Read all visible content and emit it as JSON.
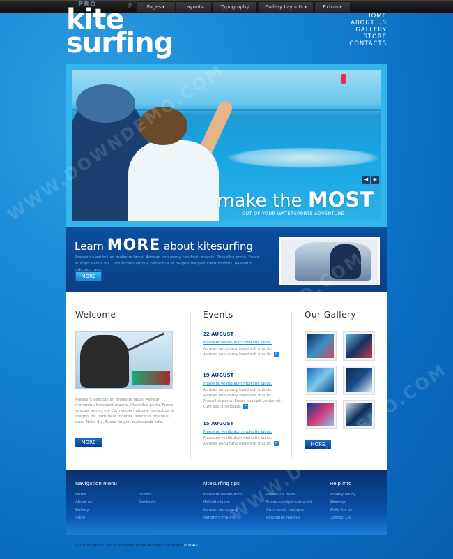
{
  "topbar": {
    "pro_label": "PRO",
    "mark": "P",
    "items": [
      {
        "label": "Pages",
        "has_chevron": true
      },
      {
        "label": "Layouts",
        "has_chevron": false
      },
      {
        "label": "Typography",
        "has_chevron": false
      },
      {
        "label": "Gallery Layouts",
        "has_chevron": true
      },
      {
        "label": "Extras",
        "has_chevron": true
      }
    ]
  },
  "logo": {
    "line1": "kite",
    "line2": "surfing"
  },
  "nav": [
    "HOME",
    "ABOUT US",
    "GALLERY",
    "STORE",
    "CONTACTS"
  ],
  "slider": {
    "title_pre": "make the ",
    "title_bold": "MOST",
    "subtitle": "OUT OF YOUR WATERSPORTS ADVENTURE",
    "prev": "◀",
    "next": "▶"
  },
  "promo": {
    "pre": "Learn ",
    "big": "MORE",
    "post": " about kitesurfing",
    "text": "Praesent vestibulum molestie lacus. Aenean nonummy hendrerit mauris. Phasellus porta. Fusce suscipit varius mi. Cum sociis natoque penatibus et magnis dis parturient montes, nascetur ridiculus mus.",
    "button": "MORE"
  },
  "welcome": {
    "title": "Welcome",
    "text": "Praesent vestibulum molestie lacus. Aenean nonummy hendrerit mauris. Phasellus porta. Fusce suscipit varius mi. Cum sociis natoque penatibus et magnis dis parturient montes, nascetur ridiculus mus. Nulla dui. Fusce feugiat malesuada odio.",
    "button": "MORE"
  },
  "events": {
    "title": "Events",
    "items": [
      {
        "date": "22 AUGUST",
        "link": "Praesent vestibulum molestie lacus.",
        "text": "Aenean nonummy hendrerit mauris. Aenean nonummy hendrerit mauris."
      },
      {
        "date": "19 AUGUST",
        "link": "Praesent vestibulum molestie lacus.",
        "text": "Aenean nonummy hendrerit mauris. Aenean nonummy hendrerit mauris. Phasellus porta. Fusce suscipit varius mi. Cum sociis natoque."
      },
      {
        "date": "15 AUGUST",
        "link": "Praesent vestibulum molestie lacus.",
        "text": "Praesent vestibulum molestie lacus. Aenean nonummy hendrerit mauris."
      }
    ]
  },
  "gallery": {
    "title": "Our Gallery",
    "button": "MORE"
  },
  "footer": {
    "col1_title": "Navigation menu",
    "col1_links": [
      "Home",
      "About us",
      "Gallery",
      "Store",
      "Events",
      "Contacts"
    ],
    "col2_title": "Kitesurfing tips",
    "col2_links": [
      "Praesent vestibulum",
      "Molestie lacus",
      "Aenean nonummy",
      "Hendrerit mauris",
      "Phasellus porta",
      "Fusce suscipit varius mi",
      "Cum sociis natoque",
      "Penatibus magnis"
    ],
    "col3_title": "Help info",
    "col3_links": [
      "Privacy Policy",
      "Sitemap",
      "Write for us",
      "Contact Us"
    ],
    "copyright": "© Copyright © 2013 Company name All rights reserved",
    "copyright_brand": "FOTRIX"
  },
  "watermark": "WWW.DOWNDEMO.COM"
}
